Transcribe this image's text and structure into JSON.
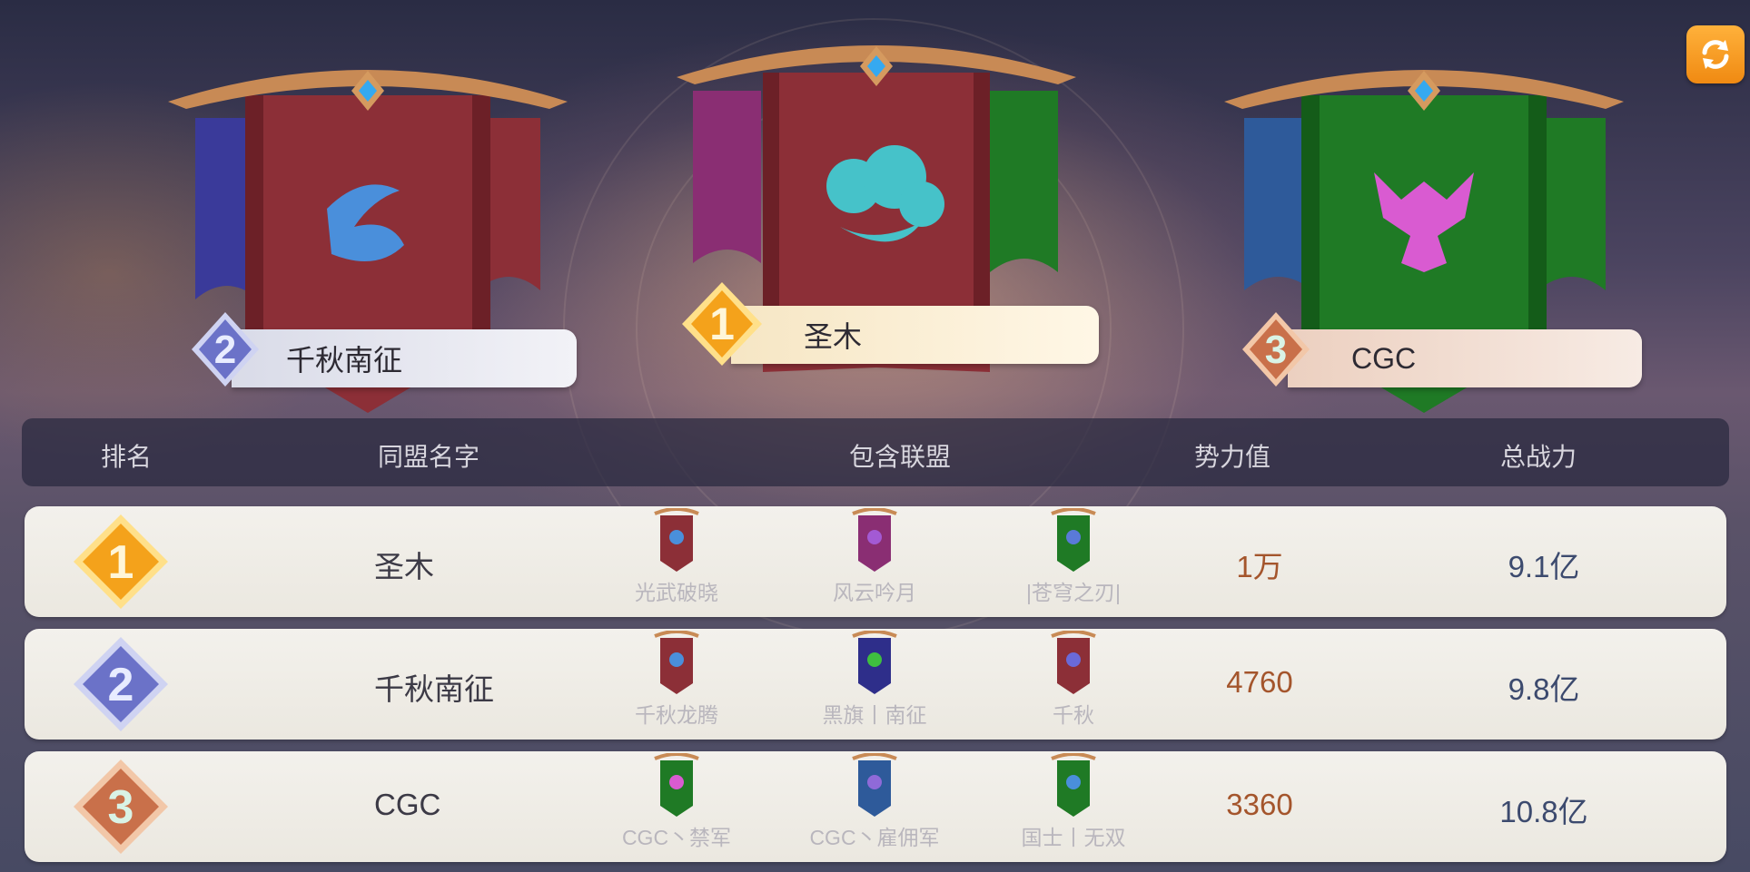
{
  "podium": {
    "first": {
      "rank": "1",
      "name": "圣木",
      "banner_color": "#8c2f37",
      "emblem_color": "#46c2c9"
    },
    "second": {
      "rank": "2",
      "name": "千秋南征",
      "banner_color": "#8c2f37",
      "emblem_color": "#4a8fdb"
    },
    "third": {
      "rank": "3",
      "name": "CGC",
      "banner_color": "#1f7a25",
      "emblem_color": "#d95bd1"
    }
  },
  "table": {
    "headers": {
      "rank": "排名",
      "alliance_name": "同盟名字",
      "members": "包含联盟",
      "power": "势力值",
      "combat": "总战力"
    },
    "rows": [
      {
        "rank": "1",
        "name": "圣木",
        "power": "1万",
        "combat": "9.1亿",
        "members": [
          {
            "label": "光武破晓",
            "color": "#8c2f37",
            "emblem": "#4a8fdb"
          },
          {
            "label": "风云吟月",
            "color": "#8a2e73",
            "emblem": "#a35ad4"
          },
          {
            "label": "|苍穹之刃|",
            "color": "#1f7a25",
            "emblem": "#5a7ad8"
          }
        ]
      },
      {
        "rank": "2",
        "name": "千秋南征",
        "power": "4760",
        "combat": "9.8亿",
        "members": [
          {
            "label": "千秋龙腾",
            "color": "#8c2f37",
            "emblem": "#4a8fdb"
          },
          {
            "label": "黑旗丨南征",
            "color": "#2e2e8a",
            "emblem": "#3fbf3f"
          },
          {
            "label": "千秋",
            "color": "#8c2f37",
            "emblem": "#6a6ad8"
          }
        ]
      },
      {
        "rank": "3",
        "name": "CGC",
        "power": "3360",
        "combat": "10.8亿",
        "members": [
          {
            "label": "CGC丶禁军",
            "color": "#1f7a25",
            "emblem": "#d95bd1"
          },
          {
            "label": "CGC丶雇佣军",
            "color": "#2e5a9a",
            "emblem": "#8f6ad8"
          },
          {
            "label": "国士丨无双",
            "color": "#1f7a25",
            "emblem": "#4a8fdb"
          }
        ]
      }
    ]
  },
  "colors": {
    "gold": "#f4a21b",
    "silver": "#7f86d4",
    "bronze": "#c9704a",
    "accent": "#f39a1e"
  },
  "icons": {
    "refresh": "refresh-icon"
  }
}
